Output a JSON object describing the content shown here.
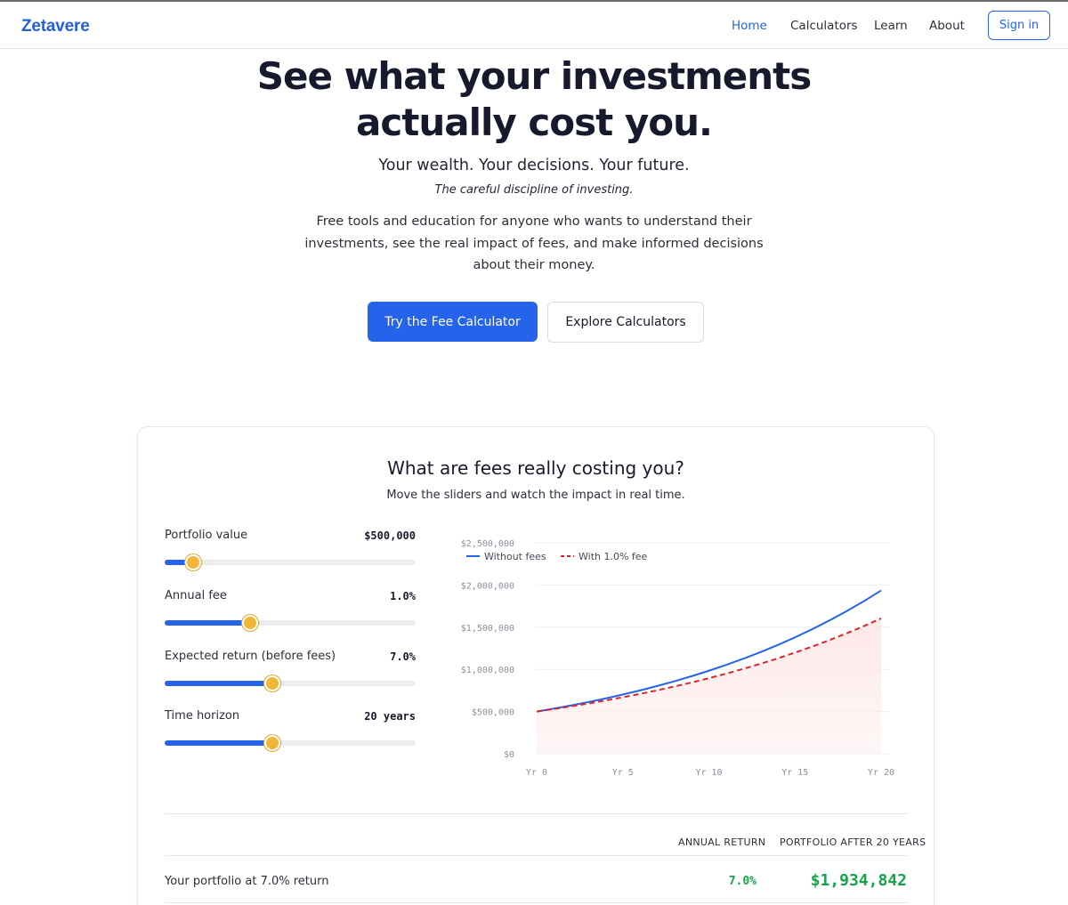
{
  "nav": {
    "logo": "Zetavere",
    "links": [
      {
        "label": "Home",
        "active": true
      },
      {
        "label": "Calculators",
        "active": false
      },
      {
        "label": "Learn",
        "active": false
      },
      {
        "label": "About",
        "active": false
      }
    ],
    "signin": "Sign in"
  },
  "hero": {
    "title_line1": "See what your investments",
    "title_line2": "actually cost you.",
    "subtitle": "Your wealth. Your decisions. Your future.",
    "tagline": "The careful discipline of investing.",
    "description": "Free tools and education for anyone who wants to understand their investments, see the real impact of fees, and make informed decisions about their money.",
    "primary_button": "Try the Fee Calculator",
    "secondary_button": "Explore Calculators"
  },
  "calculator": {
    "title": "What are fees really costing you?",
    "subtitle": "Move the sliders and watch the impact in real time.",
    "sliders": [
      {
        "label": "Portfolio value",
        "value": "$500,000",
        "fraction": 0.115
      },
      {
        "label": "Annual fee",
        "value": "1.0%",
        "fraction": 0.34
      },
      {
        "label": "Expected return (before fees)",
        "value": "7.0%",
        "fraction": 0.43
      },
      {
        "label": "Time horizon",
        "value": "20 years",
        "fraction": 0.43
      }
    ],
    "table": {
      "col_return": "ANNUAL RETURN",
      "col_portfolio": "PORTFOLIO AFTER 20 YEARS",
      "row_label": "Your portfolio at 7.0% return",
      "row_return": "7.0%",
      "row_value": "$1,934,842"
    }
  },
  "colors": {
    "accent": "#2563eb",
    "fee_line": "#dc2626",
    "thumb": "#f2b636",
    "positive": "#16a34a"
  },
  "chart_data": {
    "type": "line",
    "x": [
      0,
      1,
      2,
      3,
      4,
      5,
      6,
      7,
      8,
      9,
      10,
      11,
      12,
      13,
      14,
      15,
      16,
      17,
      18,
      19,
      20
    ],
    "x_tick_labels": [
      "Yr 0",
      "Yr 5",
      "Yr 10",
      "Yr 15",
      "Yr 20"
    ],
    "x_ticks": [
      0,
      5,
      10,
      15,
      20
    ],
    "y_tick_labels": [
      "$2,500,000",
      "$2,000,000",
      "$1,500,000",
      "$1,000,000",
      "$500,000",
      "$0"
    ],
    "y_ticks": [
      2500000,
      2000000,
      1500000,
      1000000,
      500000,
      0
    ],
    "ylim": [
      0,
      2500000
    ],
    "xlim": [
      0,
      20
    ],
    "legend_position": "top-left",
    "grid": true,
    "series": [
      {
        "name": "Without fees",
        "style": "solid",
        "color": "#2563eb",
        "values": [
          500000,
          535000,
          572450,
          612522,
          655398,
          701276,
          750365,
          802891,
          859093,
          919230,
          983576,
          1052426,
          1126096,
          1204923,
          1289267,
          1379516,
          1476082,
          1579408,
          1689966,
          1808264,
          1934842
        ]
      },
      {
        "name": "With 1.0% fee",
        "style": "dashed",
        "color": "#dc2626",
        "fill": true,
        "values": [
          500000,
          530000,
          561800,
          595508,
          631238,
          669113,
          709260,
          751816,
          796925,
          844741,
          895425,
          949151,
          1006100,
          1066466,
          1130454,
          1198281,
          1270178,
          1346388,
          1427172,
          1512802,
          1603568
        ]
      }
    ]
  }
}
